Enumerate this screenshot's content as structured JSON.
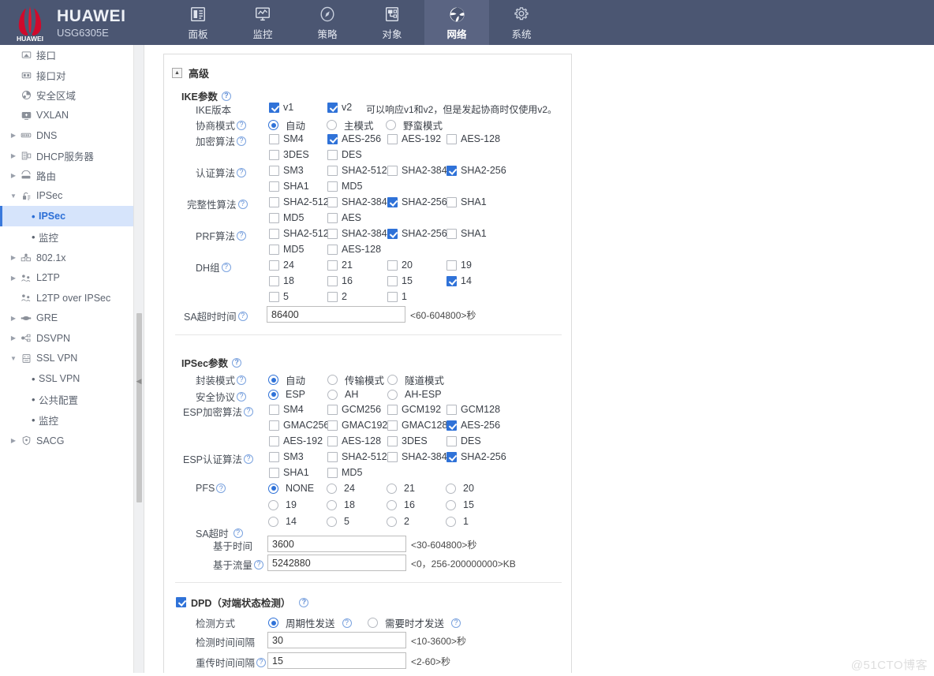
{
  "header": {
    "brand_name": "HUAWEI",
    "brand_model": "USG6305E",
    "logo_text": "HUAWEI",
    "nav": [
      {
        "label": "面板",
        "icon": "dashboard-icon",
        "active": false
      },
      {
        "label": "监控",
        "icon": "monitor-icon",
        "active": false
      },
      {
        "label": "策略",
        "icon": "policy-compass-icon",
        "active": false
      },
      {
        "label": "对象",
        "icon": "object-icon",
        "active": false
      },
      {
        "label": "网络",
        "icon": "network-globe-icon",
        "active": true
      },
      {
        "label": "系统",
        "icon": "gear-icon",
        "active": false
      }
    ]
  },
  "sidebar": {
    "items": [
      {
        "label": "接口",
        "icon": "interface-icon",
        "arrow": "none",
        "indent": 0
      },
      {
        "label": "接口对",
        "icon": "interface-pair-icon",
        "arrow": "none",
        "indent": 0
      },
      {
        "label": "安全区域",
        "icon": "security-zone-icon",
        "arrow": "none",
        "indent": 0
      },
      {
        "label": "VXLAN",
        "icon": "vxlan-icon",
        "arrow": "none",
        "indent": 0
      },
      {
        "label": "DNS",
        "icon": "dns-icon",
        "arrow": "collapsed",
        "indent": 0
      },
      {
        "label": "DHCP服务器",
        "icon": "dhcp-icon",
        "arrow": "collapsed",
        "indent": 0
      },
      {
        "label": "路由",
        "icon": "route-icon",
        "arrow": "collapsed",
        "indent": 0
      },
      {
        "label": "IPSec",
        "icon": "ipsec-lock-icon",
        "arrow": "expanded",
        "indent": 0
      },
      {
        "label": "IPSec",
        "icon": "bullet",
        "arrow": "sub",
        "indent": 1,
        "selected": true
      },
      {
        "label": "监控",
        "icon": "bullet",
        "arrow": "sub",
        "indent": 1,
        "selected": false
      },
      {
        "label": "802.1x",
        "icon": "dot1x-icon",
        "arrow": "collapsed",
        "indent": 0
      },
      {
        "label": "L2TP",
        "icon": "l2tp-icon",
        "arrow": "collapsed",
        "indent": 0
      },
      {
        "label": "L2TP over IPSec",
        "icon": "l2tp-ipsec-icon",
        "arrow": "none",
        "indent": 0
      },
      {
        "label": "GRE",
        "icon": "gre-icon",
        "arrow": "collapsed",
        "indent": 0
      },
      {
        "label": "DSVPN",
        "icon": "dsvpn-icon",
        "arrow": "collapsed",
        "indent": 0
      },
      {
        "label": "SSL VPN",
        "icon": "sslvpn-icon",
        "arrow": "expanded",
        "indent": 0
      },
      {
        "label": "SSL VPN",
        "icon": "bullet",
        "arrow": "sub",
        "indent": 1,
        "selected": false
      },
      {
        "label": "公共配置",
        "icon": "bullet",
        "arrow": "sub",
        "indent": 1,
        "selected": false
      },
      {
        "label": "监控",
        "icon": "bullet",
        "arrow": "sub",
        "indent": 1,
        "selected": false
      },
      {
        "label": "SACG",
        "icon": "sacg-shield-icon",
        "arrow": "collapsed",
        "indent": 0
      }
    ]
  },
  "panel": {
    "section_title": "高级",
    "collapse_glyph": "▲",
    "help_glyph": "?",
    "ike": {
      "group_title": "IKE参数",
      "version_label": "IKE版本",
      "version_opts": [
        {
          "label": "v1",
          "checked": true
        },
        {
          "label": "v2",
          "checked": true
        }
      ],
      "version_note": "可以响应v1和v2，但是发起协商时仅使用v2。",
      "mode_label": "协商模式",
      "mode_opts": [
        {
          "label": "自动",
          "checked": true
        },
        {
          "label": "主模式",
          "checked": false
        },
        {
          "label": "野蛮模式",
          "checked": false
        }
      ],
      "enc_label": "加密算法",
      "enc_opts": [
        {
          "label": "SM4",
          "checked": false
        },
        {
          "label": "AES-256",
          "checked": true
        },
        {
          "label": "AES-192",
          "checked": false
        },
        {
          "label": "AES-128",
          "checked": false
        },
        {
          "label": "3DES",
          "checked": false
        },
        {
          "label": "DES",
          "checked": false
        }
      ],
      "auth_label": "认证算法",
      "auth_opts": [
        {
          "label": "SM3",
          "checked": false
        },
        {
          "label": "SHA2-512",
          "checked": false
        },
        {
          "label": "SHA2-384",
          "checked": false
        },
        {
          "label": "SHA2-256",
          "checked": true
        },
        {
          "label": "SHA1",
          "checked": false
        },
        {
          "label": "MD5",
          "checked": false
        }
      ],
      "integrity_label": "完整性算法",
      "integrity_opts": [
        {
          "label": "SHA2-512",
          "checked": false
        },
        {
          "label": "SHA2-384",
          "checked": false
        },
        {
          "label": "SHA2-256",
          "checked": true
        },
        {
          "label": "SHA1",
          "checked": false
        },
        {
          "label": "MD5",
          "checked": false
        },
        {
          "label": "AES",
          "checked": false
        }
      ],
      "prf_label": "PRF算法",
      "prf_opts": [
        {
          "label": "SHA2-512",
          "checked": false
        },
        {
          "label": "SHA2-384",
          "checked": false
        },
        {
          "label": "SHA2-256",
          "checked": true
        },
        {
          "label": "SHA1",
          "checked": false
        },
        {
          "label": "MD5",
          "checked": false
        },
        {
          "label": "AES-128",
          "checked": false
        }
      ],
      "dh_label": "DH组",
      "dh_opts": [
        {
          "label": "24",
          "checked": false
        },
        {
          "label": "21",
          "checked": false
        },
        {
          "label": "20",
          "checked": false
        },
        {
          "label": "19",
          "checked": false
        },
        {
          "label": "18",
          "checked": false
        },
        {
          "label": "16",
          "checked": false
        },
        {
          "label": "15",
          "checked": false
        },
        {
          "label": "14",
          "checked": true
        },
        {
          "label": "5",
          "checked": false
        },
        {
          "label": "2",
          "checked": false
        },
        {
          "label": "1",
          "checked": false
        }
      ],
      "sa_timeout_label": "SA超时时间",
      "sa_timeout_value": "86400",
      "sa_timeout_hint": "<60-604800>秒"
    },
    "ipsec": {
      "group_title": "IPSec参数",
      "encap_label": "封装模式",
      "encap_opts": [
        {
          "label": "自动",
          "checked": true
        },
        {
          "label": "传输模式",
          "checked": false
        },
        {
          "label": "隧道模式",
          "checked": false
        }
      ],
      "proto_label": "安全协议",
      "proto_opts": [
        {
          "label": "ESP",
          "checked": true
        },
        {
          "label": "AH",
          "checked": false
        },
        {
          "label": "AH-ESP",
          "checked": false
        }
      ],
      "esp_enc_label": "ESP加密算法",
      "esp_enc_opts": [
        {
          "label": "SM4",
          "checked": false
        },
        {
          "label": "GCM256",
          "checked": false
        },
        {
          "label": "GCM192",
          "checked": false
        },
        {
          "label": "GCM128",
          "checked": false
        },
        {
          "label": "GMAC256",
          "checked": false
        },
        {
          "label": "GMAC192",
          "checked": false
        },
        {
          "label": "GMAC128",
          "checked": false
        },
        {
          "label": "AES-256",
          "checked": true
        },
        {
          "label": "AES-192",
          "checked": false
        },
        {
          "label": "AES-128",
          "checked": false
        },
        {
          "label": "3DES",
          "checked": false
        },
        {
          "label": "DES",
          "checked": false
        }
      ],
      "esp_auth_label": "ESP认证算法",
      "esp_auth_opts": [
        {
          "label": "SM3",
          "checked": false
        },
        {
          "label": "SHA2-512",
          "checked": false
        },
        {
          "label": "SHA2-384",
          "checked": false
        },
        {
          "label": "SHA2-256",
          "checked": true
        },
        {
          "label": "SHA1",
          "checked": false
        },
        {
          "label": "MD5",
          "checked": false
        }
      ],
      "pfs_label": "PFS",
      "pfs_opts": [
        {
          "label": "NONE",
          "checked": true
        },
        {
          "label": "24",
          "checked": false
        },
        {
          "label": "21",
          "checked": false
        },
        {
          "label": "20",
          "checked": false
        },
        {
          "label": "19",
          "checked": false
        },
        {
          "label": "18",
          "checked": false
        },
        {
          "label": "16",
          "checked": false
        },
        {
          "label": "15",
          "checked": false
        },
        {
          "label": "14",
          "checked": false
        },
        {
          "label": "5",
          "checked": false
        },
        {
          "label": "2",
          "checked": false
        },
        {
          "label": "1",
          "checked": false
        }
      ],
      "sa_group_label": "SA超时",
      "sa_time_label": "基于时间",
      "sa_time_value": "3600",
      "sa_time_hint": "<30-604800>秒",
      "sa_traffic_label": "基于流量",
      "sa_traffic_value": "5242880",
      "sa_traffic_hint": "<0，256-200000000>KB"
    },
    "dpd": {
      "title": "DPD（对端状态检测）",
      "enabled": true,
      "method_label": "检测方式",
      "method_opts": [
        {
          "label": "周期性发送",
          "checked": true
        },
        {
          "label": "需要时才发送",
          "checked": false
        }
      ],
      "interval_label": "检测时间间隔",
      "interval_value": "30",
      "interval_hint": "<10-3600>秒",
      "retrans_label": "重传时间间隔",
      "retrans_value": "15",
      "retrans_hint": "<2-60>秒"
    }
  },
  "watermark": "@51CTO博客",
  "colors": {
    "header_bg": "#4b5672",
    "header_active": "#5a6482",
    "accent_blue": "#2f72d8",
    "sidebar_sel_bg": "#d6e4fb",
    "sidebar_sel_text": "#2b6ed6",
    "huawei_red": "#cf0a2c"
  }
}
